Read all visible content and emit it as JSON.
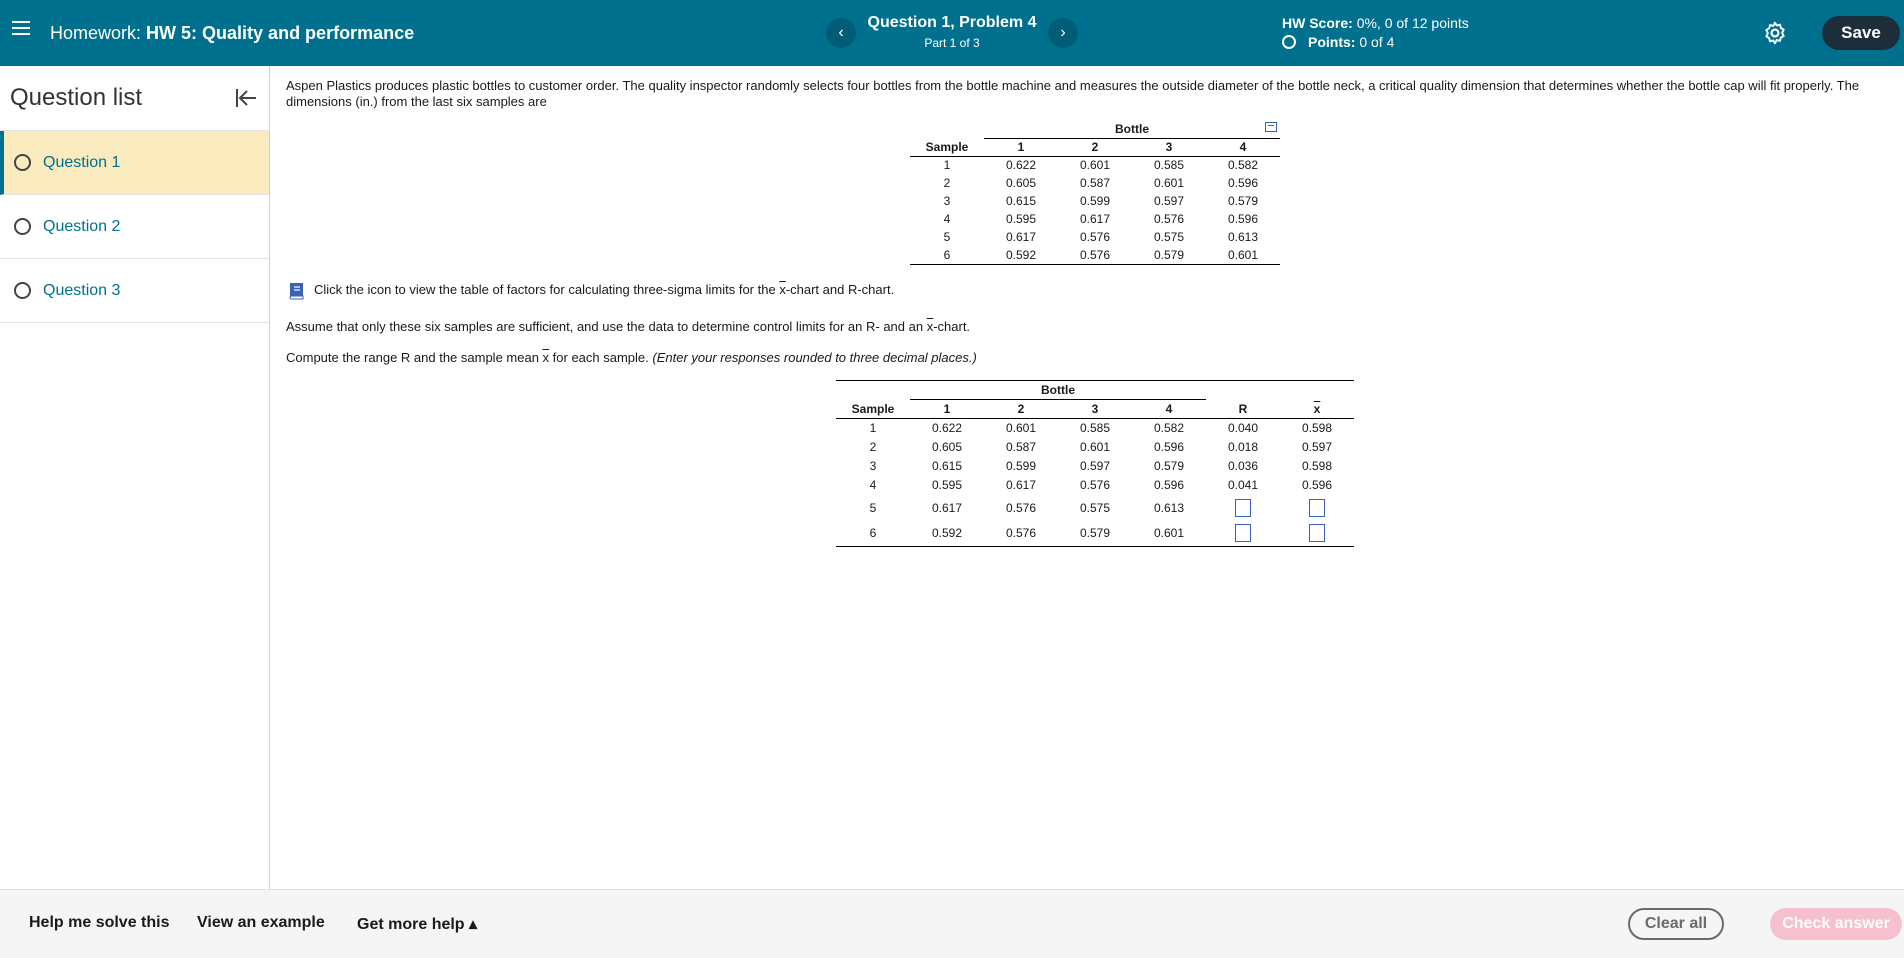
{
  "header": {
    "menu_icon": "hamburger-icon",
    "homework_prefix": "Homework:",
    "homework_name": "HW 5: Quality and performance",
    "question_title": "Question 1, Problem 4",
    "part_label": "Part 1 of 3",
    "prev_icon": "chevron-left-icon",
    "next_icon": "chevron-right-icon",
    "hw_score_label": "HW Score:",
    "hw_score_value": "0%, 0 of 12 points",
    "points_label": "Points:",
    "points_value": "0 of 4",
    "settings_icon": "gear-icon",
    "save_label": "Save"
  },
  "sidebar": {
    "title": "Question list",
    "items": [
      {
        "label": "Question 1",
        "active": true
      },
      {
        "label": "Question 2",
        "active": false
      },
      {
        "label": "Question 3",
        "active": false
      }
    ]
  },
  "main": {
    "intro": "Aspen Plastics produces plastic bottles to customer order. The quality inspector randomly selects four bottles from the bottle machine and measures the outside diameter of the bottle neck, a critical quality dimension that determines whether the bottle cap will fit properly. The dimensions (in.) from the last six samples are",
    "table1": {
      "group_header": "Bottle",
      "headers": [
        "Sample",
        "1",
        "2",
        "3",
        "4"
      ],
      "rows": [
        [
          "1",
          "0.622",
          "0.601",
          "0.585",
          "0.582"
        ],
        [
          "2",
          "0.605",
          "0.587",
          "0.601",
          "0.596"
        ],
        [
          "3",
          "0.615",
          "0.599",
          "0.597",
          "0.579"
        ],
        [
          "4",
          "0.595",
          "0.617",
          "0.576",
          "0.596"
        ],
        [
          "5",
          "0.617",
          "0.576",
          "0.575",
          "0.613"
        ],
        [
          "6",
          "0.592",
          "0.576",
          "0.579",
          "0.601"
        ]
      ]
    },
    "click_text_a": "Click the icon to view the table of factors for calculating three-sigma limits for the ",
    "click_text_x": "x",
    "click_text_b": "-chart and R-chart.",
    "assume_a": "Assume that only these six samples are sufficient, and use the data to determine control limits for an R- and an ",
    "assume_x": "x",
    "assume_b": "-chart.",
    "compute_a": "Compute the range R and the sample mean ",
    "compute_x": "x",
    "compute_b": " for each sample. ",
    "compute_italic": "(Enter your responses rounded to three decimal places.)",
    "table2": {
      "group_header": "Bottle",
      "headers": [
        "Sample",
        "1",
        "2",
        "3",
        "4",
        "R",
        "x"
      ],
      "rows": [
        [
          "1",
          "0.622",
          "0.601",
          "0.585",
          "0.582",
          "0.040",
          "0.598"
        ],
        [
          "2",
          "0.605",
          "0.587",
          "0.601",
          "0.596",
          "0.018",
          "0.597"
        ],
        [
          "3",
          "0.615",
          "0.599",
          "0.597",
          "0.579",
          "0.036",
          "0.598"
        ],
        [
          "4",
          "0.595",
          "0.617",
          "0.576",
          "0.596",
          "0.041",
          "0.596"
        ],
        [
          "5",
          "0.617",
          "0.576",
          "0.575",
          "0.613",
          "",
          ""
        ],
        [
          "6",
          "0.592",
          "0.576",
          "0.579",
          "0.601",
          "",
          ""
        ]
      ]
    }
  },
  "footer": {
    "help_solve": "Help me solve this",
    "view_example": "View an example",
    "more_help": "Get more help ▴",
    "clear_label": "Clear all",
    "check_label": "Check answer"
  },
  "colors": {
    "topbar": "#00708f",
    "save_button": "#1d2e3b",
    "active_question_bg": "#f9ebbe",
    "check_answer_disabled": "#f7c0ce"
  }
}
